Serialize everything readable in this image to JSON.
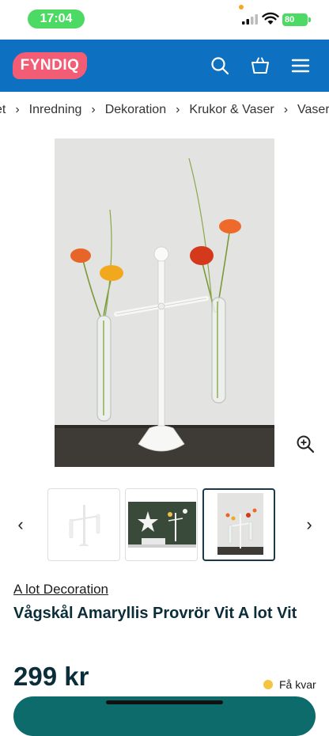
{
  "status_bar": {
    "time": "17:04",
    "battery": "80"
  },
  "header": {
    "logo": "FYNDIQ",
    "icons": [
      "search-icon",
      "cart-icon",
      "menu-icon"
    ],
    "bg_color": "#0e70c0",
    "logo_color": "#f25c74"
  },
  "breadcrumb": {
    "items": [
      "et",
      "Inredning",
      "Dekoration",
      "Krukor & Vaser",
      "Vaser"
    ]
  },
  "gallery": {
    "prev_label": "‹",
    "next_label": "›",
    "active_index": 2
  },
  "product": {
    "brand": "A lot Decoration",
    "title": "Vågskål Amaryllis Provrör Vit A lot Vit",
    "price": "299 kr",
    "stock": "Få kvar",
    "stock_color": "#f5c542"
  }
}
